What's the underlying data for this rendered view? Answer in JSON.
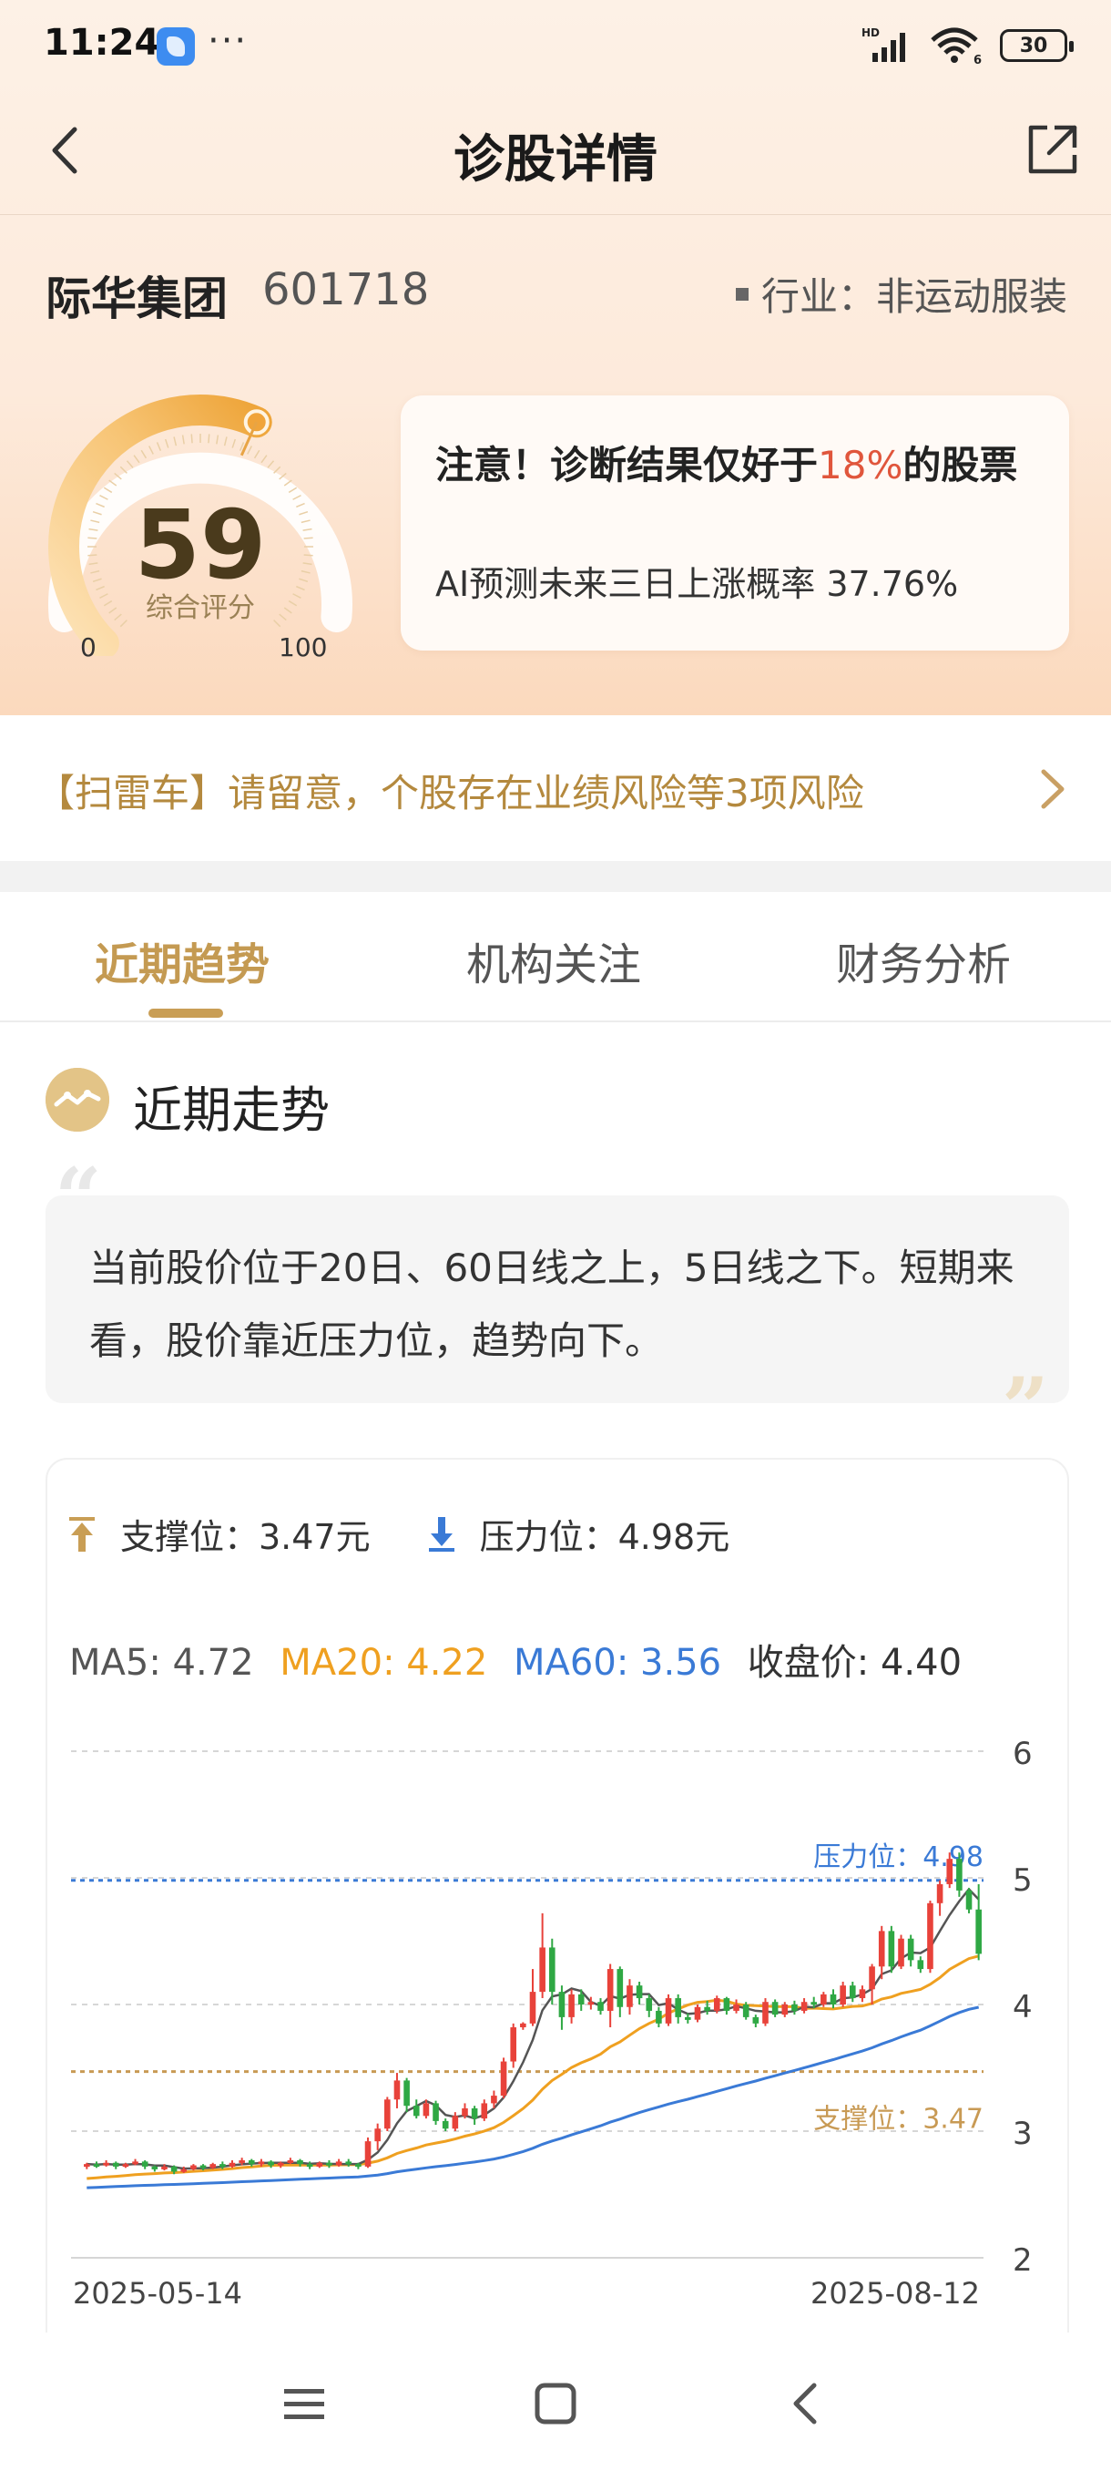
{
  "status_bar": {
    "time": "11:24",
    "dots": "···",
    "battery": "30",
    "network_label": "HD",
    "wifi_badge": "6",
    "icons": [
      "app-icon",
      "signal-icon",
      "wifi-icon",
      "battery-icon"
    ]
  },
  "nav": {
    "title": "诊股详情",
    "back_icon": "back-arrow-icon",
    "share_icon": "share-icon"
  },
  "stock": {
    "name": "际华集团",
    "code": "601718",
    "industry": "行业：非运动服装"
  },
  "gauge": {
    "score": "59",
    "label": "综合评分",
    "min": "0",
    "max": "100",
    "score_fraction": 0.59
  },
  "diagnosis": {
    "text_before": "注意！诊断结果仅好于",
    "highlight": "18%",
    "text_after": "的股票",
    "ai_label": "AI预测未来三日上涨概率",
    "ai_value": "37.76%"
  },
  "scan": {
    "text": "【扫雷车】请留意，个股存在业绩风险等3项风险"
  },
  "tabs": [
    {
      "label": "近期趋势",
      "active": true
    },
    {
      "label": "机构关注",
      "active": false
    },
    {
      "label": "财务分析",
      "active": false
    }
  ],
  "section": {
    "title": "近期走势",
    "summary": "当前股价位于20日、60日线之上，5日线之下。短期来看，股价靠近压力位，趋势向下。",
    "quote_open": "“",
    "quote_close": "”"
  },
  "levels": {
    "support_label": "支撑位：3.47元",
    "resistance_label": "压力位：4.98元"
  },
  "ma": {
    "ma5": "MA5: 4.72",
    "ma20": "MA20: 4.22",
    "ma60": "MA60: 3.56",
    "close": "收盘价: 4.40"
  },
  "chart_data": {
    "type": "candlestick",
    "y_ticks": [
      "6",
      "5",
      "4",
      "3",
      "2"
    ],
    "ylim": [
      2,
      6
    ],
    "x_labels": [
      "2025-05-14",
      "2025-08-12"
    ],
    "resistance": {
      "label": "压力位：4.98",
      "value": 4.98
    },
    "support": {
      "label": "支撑位：3.47",
      "value": 3.47
    },
    "colors": {
      "up": "#e8423a",
      "down": "#2fa844",
      "ma5": "#555555",
      "ma20": "#efa020",
      "ma60": "#3a7ad6",
      "resistance": "#3a7ad6",
      "support": "#c89a54"
    },
    "candles": [
      [
        2.72,
        2.74,
        2.7,
        2.75
      ],
      [
        2.74,
        2.73,
        2.71,
        2.76
      ],
      [
        2.73,
        2.75,
        2.72,
        2.77
      ],
      [
        2.75,
        2.72,
        2.7,
        2.76
      ],
      [
        2.72,
        2.74,
        2.71,
        2.75
      ],
      [
        2.74,
        2.76,
        2.73,
        2.78
      ],
      [
        2.76,
        2.72,
        2.7,
        2.77
      ],
      [
        2.72,
        2.7,
        2.68,
        2.73
      ],
      [
        2.7,
        2.72,
        2.69,
        2.74
      ],
      [
        2.72,
        2.68,
        2.66,
        2.73
      ],
      [
        2.68,
        2.7,
        2.67,
        2.72
      ],
      [
        2.7,
        2.73,
        2.69,
        2.74
      ],
      [
        2.73,
        2.71,
        2.69,
        2.74
      ],
      [
        2.71,
        2.74,
        2.7,
        2.75
      ],
      [
        2.74,
        2.72,
        2.7,
        2.76
      ],
      [
        2.72,
        2.75,
        2.71,
        2.77
      ],
      [
        2.75,
        2.77,
        2.73,
        2.79
      ],
      [
        2.77,
        2.74,
        2.72,
        2.78
      ],
      [
        2.74,
        2.76,
        2.72,
        2.78
      ],
      [
        2.76,
        2.73,
        2.71,
        2.77
      ],
      [
        2.73,
        2.75,
        2.71,
        2.76
      ],
      [
        2.75,
        2.77,
        2.74,
        2.79
      ],
      [
        2.77,
        2.74,
        2.72,
        2.78
      ],
      [
        2.74,
        2.72,
        2.7,
        2.76
      ],
      [
        2.72,
        2.75,
        2.71,
        2.76
      ],
      [
        2.75,
        2.73,
        2.71,
        2.77
      ],
      [
        2.73,
        2.76,
        2.72,
        2.78
      ],
      [
        2.76,
        2.74,
        2.72,
        2.78
      ],
      [
        2.74,
        2.72,
        2.7,
        2.75
      ],
      [
        2.72,
        2.92,
        2.71,
        2.95
      ],
      [
        2.92,
        3.02,
        2.85,
        3.06
      ],
      [
        3.02,
        3.25,
        3.0,
        3.27
      ],
      [
        3.25,
        3.4,
        3.18,
        3.46
      ],
      [
        3.4,
        3.2,
        3.15,
        3.42
      ],
      [
        3.2,
        3.12,
        3.1,
        3.25
      ],
      [
        3.12,
        3.22,
        3.1,
        3.25
      ],
      [
        3.22,
        3.08,
        3.05,
        3.24
      ],
      [
        3.08,
        3.02,
        3.0,
        3.1
      ],
      [
        3.02,
        3.12,
        3.0,
        3.15
      ],
      [
        3.12,
        3.18,
        3.1,
        3.22
      ],
      [
        3.18,
        3.1,
        3.05,
        3.2
      ],
      [
        3.1,
        3.22,
        3.08,
        3.25
      ],
      [
        3.22,
        3.28,
        3.18,
        3.32
      ],
      [
        3.28,
        3.55,
        3.26,
        3.58
      ],
      [
        3.55,
        3.82,
        3.5,
        3.85
      ],
      [
        3.82,
        3.85,
        3.8,
        3.86
      ],
      [
        3.85,
        4.1,
        3.83,
        4.28
      ],
      [
        4.1,
        4.45,
        4.05,
        4.72
      ],
      [
        4.45,
        4.1,
        4.0,
        4.52
      ],
      [
        4.1,
        3.9,
        3.8,
        4.15
      ],
      [
        3.9,
        4.08,
        3.85,
        4.12
      ],
      [
        4.08,
        4.0,
        3.95,
        4.12
      ],
      [
        4.0,
        4.02,
        3.96,
        4.06
      ],
      [
        4.02,
        3.95,
        3.92,
        4.05
      ],
      [
        3.95,
        4.28,
        3.82,
        4.32
      ],
      [
        4.28,
        3.98,
        3.9,
        4.3
      ],
      [
        3.98,
        4.15,
        3.92,
        4.2
      ],
      [
        4.15,
        4.05,
        4.0,
        4.18
      ],
      [
        4.05,
        3.95,
        3.9,
        4.08
      ],
      [
        3.95,
        3.85,
        3.82,
        3.98
      ],
      [
        3.85,
        4.05,
        3.83,
        4.08
      ],
      [
        4.05,
        3.9,
        3.85,
        4.08
      ],
      [
        3.9,
        3.88,
        3.85,
        3.93
      ],
      [
        3.88,
        3.98,
        3.86,
        4.0
      ],
      [
        3.98,
        3.95,
        3.92,
        4.03
      ],
      [
        3.95,
        4.05,
        3.93,
        4.07
      ],
      [
        4.05,
        3.95,
        3.92,
        4.06
      ],
      [
        3.95,
        4.0,
        3.93,
        4.04
      ],
      [
        4.0,
        3.9,
        3.88,
        4.02
      ],
      [
        3.9,
        3.85,
        3.82,
        3.92
      ],
      [
        3.85,
        4.02,
        3.83,
        4.05
      ],
      [
        4.02,
        3.92,
        3.9,
        4.04
      ],
      [
        3.92,
        4.0,
        3.9,
        4.02
      ],
      [
        4.0,
        3.95,
        3.92,
        4.03
      ],
      [
        3.95,
        4.02,
        3.93,
        4.05
      ],
      [
        4.02,
        4.0,
        3.97,
        4.06
      ],
      [
        4.0,
        4.08,
        3.98,
        4.1
      ],
      [
        4.08,
        4.0,
        3.97,
        4.12
      ],
      [
        4.0,
        4.15,
        3.98,
        4.18
      ],
      [
        4.15,
        4.05,
        4.02,
        4.18
      ],
      [
        4.05,
        4.12,
        4.02,
        4.15
      ],
      [
        4.12,
        4.3,
        4.0,
        4.32
      ],
      [
        4.3,
        4.58,
        4.2,
        4.62
      ],
      [
        4.58,
        4.3,
        4.25,
        4.62
      ],
      [
        4.3,
        4.52,
        4.28,
        4.55
      ],
      [
        4.52,
        4.35,
        4.3,
        4.55
      ],
      [
        4.35,
        4.28,
        4.25,
        4.38
      ],
      [
        4.28,
        4.8,
        4.25,
        4.82
      ],
      [
        4.8,
        4.95,
        4.7,
        4.98
      ],
      [
        4.95,
        5.15,
        4.92,
        5.2
      ],
      [
        5.15,
        4.9,
        4.85,
        5.2
      ],
      [
        4.9,
        4.75,
        4.72,
        4.92
      ],
      [
        4.75,
        4.4,
        4.35,
        4.95
      ]
    ]
  },
  "bottom_nav": {
    "icons": [
      "menu-icon",
      "home-icon",
      "back-icon"
    ]
  }
}
